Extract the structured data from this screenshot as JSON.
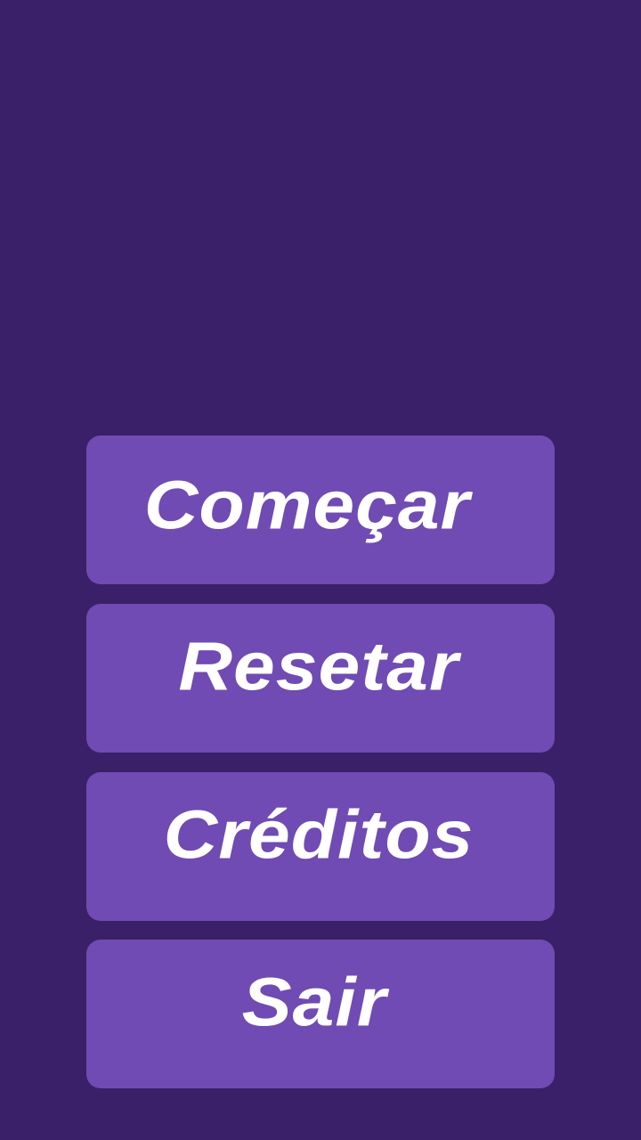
{
  "menu": {
    "start_label": "Começar",
    "reset_label": "Resetar",
    "credits_label": "Créditos",
    "exit_label": "Sair"
  },
  "colors": {
    "background": "#3a2068",
    "button": "#6f4bb3",
    "text": "#ffffff"
  }
}
